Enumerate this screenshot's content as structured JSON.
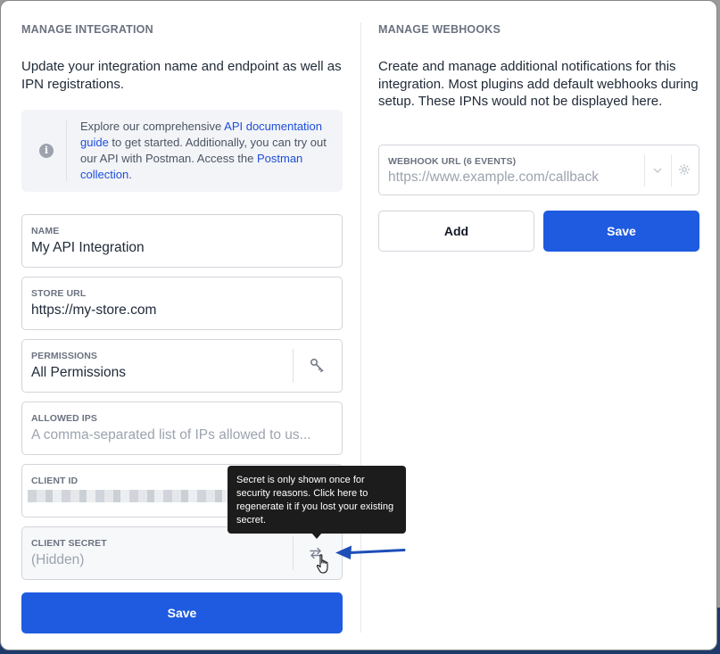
{
  "left": {
    "title": "MANAGE INTEGRATION",
    "description": "Update your integration name and endpoint as well as IPN registrations.",
    "info": {
      "text_1": "Explore our comprehensive ",
      "link_1": "API documentation guide",
      "text_2": " to get started. Additionally, you can try out our API with Postman. Access the ",
      "link_2": "Postman collection",
      "text_3": "."
    },
    "fields": {
      "name": {
        "label": "NAME",
        "value": "My API Integration"
      },
      "store_url": {
        "label": "STORE URL",
        "value": "https://my-store.com"
      },
      "permissions": {
        "label": "PERMISSIONS",
        "value": "All Permissions"
      },
      "allowed_ips": {
        "label": "ALLOWED IPS",
        "placeholder": "A comma-separated list of IPs allowed to us..."
      },
      "client_id": {
        "label": "CLIENT ID"
      },
      "client_secret": {
        "label": "CLIENT SECRET",
        "value": "(Hidden)"
      }
    },
    "save_label": "Save"
  },
  "tooltip": {
    "text": "Secret is only shown once for security reasons. Click here to regenerate it if you lost your existing secret."
  },
  "right": {
    "title": "MANAGE WEBHOOKS",
    "description": "Create and manage additional notifications for this integration. Most plugins add default webhooks during setup. These IPNs would not be displayed here.",
    "webhook": {
      "label": "WEBHOOK URL (6 EVENTS)",
      "placeholder": "https://www.example.com/callback"
    },
    "add_label": "Add",
    "save_label": "Save"
  },
  "colors": {
    "primary": "#1e5be0",
    "annotation_arrow": "#1e4fb8"
  }
}
